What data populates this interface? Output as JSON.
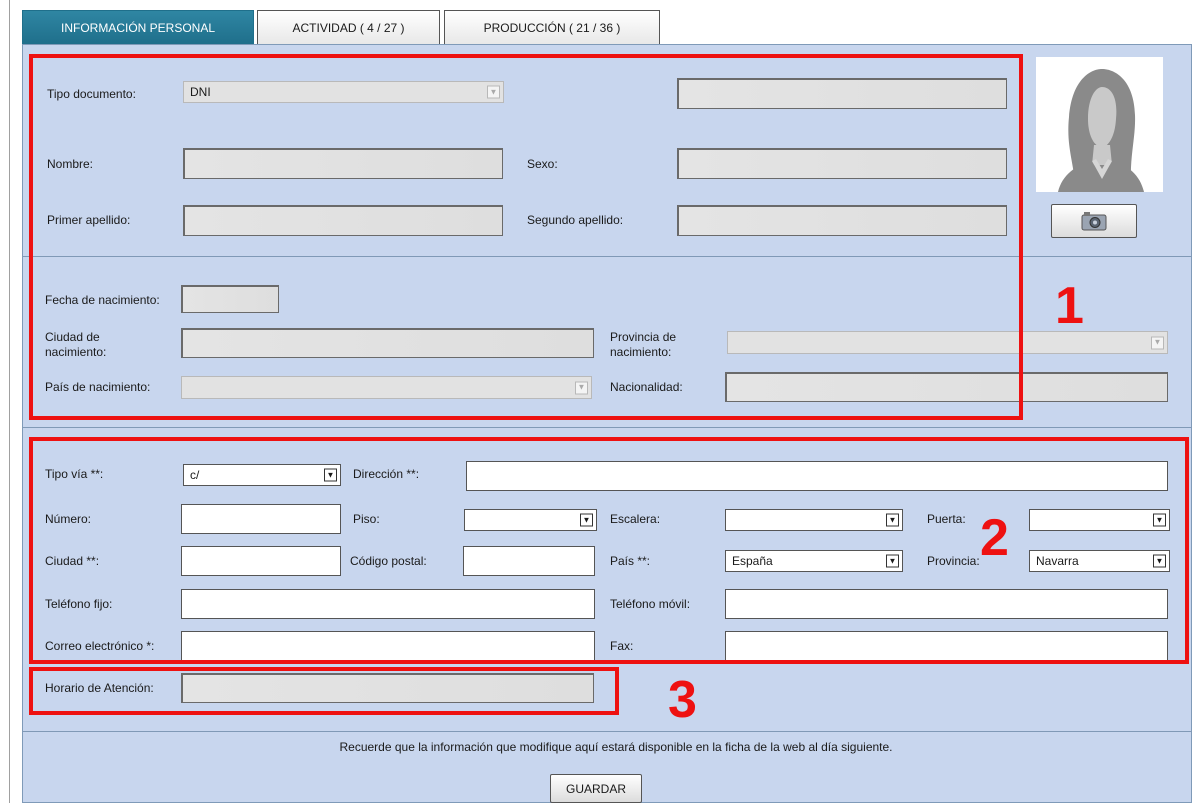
{
  "tabs": [
    {
      "label": "INFORMACIÓN PERSONAL"
    },
    {
      "label": "ACTIVIDAD ( 4 / 27 )"
    },
    {
      "label": "PRODUCCIÓN ( 21 / 36 )"
    }
  ],
  "personal": {
    "tipo_documento_label": "Tipo documento:",
    "tipo_documento_value": "DNI",
    "nombre_label": "Nombre:",
    "sexo_label": "Sexo:",
    "primer_apellido_label": "Primer apellido:",
    "segundo_apellido_label": "Segundo apellido:"
  },
  "nacimiento": {
    "fecha_label": "Fecha de nacimiento:",
    "ciudad_label_1": "Ciudad de",
    "ciudad_label_2": "nacimiento:",
    "provincia_label_1": "Provincia de",
    "provincia_label_2": "nacimiento:",
    "pais_label": "País de nacimiento:",
    "nacionalidad_label": "Nacionalidad:"
  },
  "direccion": {
    "tipo_via_label": "Tipo vía **:",
    "tipo_via_value": "c/",
    "direccion_label": "Dirección **:",
    "numero_label": "Número:",
    "piso_label": "Piso:",
    "escalera_label": "Escalera:",
    "puerta_label": "Puerta:",
    "ciudad_label": "Ciudad **:",
    "codigo_postal_label": "Código postal:",
    "pais_label": "País **:",
    "pais_value": "España",
    "provincia_label": "Provincia:",
    "provincia_value": "Navarra",
    "telefono_fijo_label": "Teléfono fijo:",
    "telefono_movil_label": "Teléfono móvil:",
    "correo_label": "Correo electrónico *:",
    "fax_label": "Fax:"
  },
  "horario": {
    "label": "Horario de Atención:"
  },
  "footer": {
    "notice": "Recuerde que la información que modifique aquí estará disponible en la ficha de la web al día siguiente.",
    "save_label": "GUARDAR"
  },
  "annotations": {
    "one": "1",
    "two": "2",
    "three": "3"
  },
  "colors": {
    "panel": "#c8d6ee",
    "active_tab": "#1f6f8b",
    "annotation_red": "#ee1111"
  }
}
